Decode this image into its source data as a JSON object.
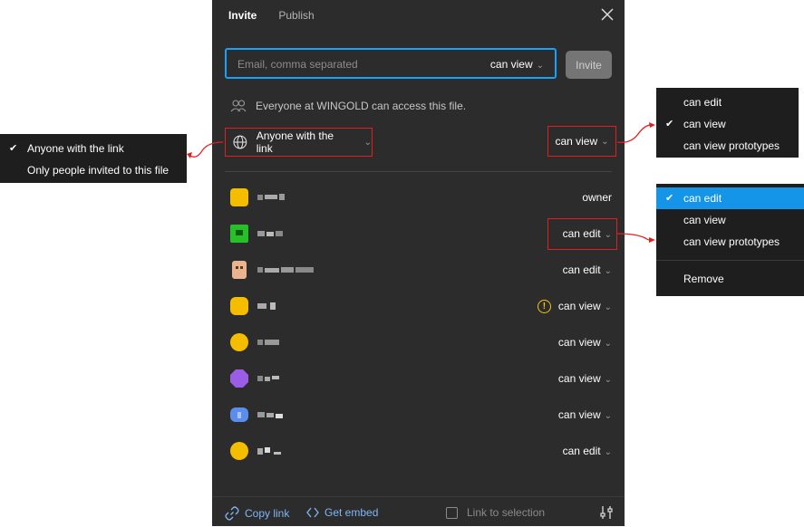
{
  "tabs": [
    {
      "label": "Invite",
      "active": true
    },
    {
      "label": "Publish",
      "active": false
    }
  ],
  "invite": {
    "placeholder": "Email, comma separated",
    "permission": "can view",
    "button": "Invite"
  },
  "org_access": "Everyone at WINGOLD can access this file.",
  "link_access": {
    "label": "Anyone with the link",
    "permission": "can view"
  },
  "users": [
    {
      "permission": "owner",
      "avatar_color": "#f5bd00"
    },
    {
      "permission": "can edit",
      "avatar_color": "#28c028"
    },
    {
      "permission": "can edit",
      "avatar_color": "#e9b48f"
    },
    {
      "permission": "can view",
      "avatar_color": "#f5bd00",
      "warning": true
    },
    {
      "permission": "can view",
      "avatar_color": "#f5bd00"
    },
    {
      "permission": "can view",
      "avatar_color": "#9b5de5"
    },
    {
      "permission": "can view",
      "avatar_color": "#5b8ded"
    },
    {
      "permission": "can edit",
      "avatar_color": "#f5bd00"
    }
  ],
  "footer": {
    "copy_link": "Copy link",
    "get_embed": "Get embed",
    "link_to_selection": "Link to selection"
  },
  "link_menu": {
    "items": [
      {
        "label": "Anyone with the link",
        "checked": true
      },
      {
        "label": "Only people invited to this file",
        "checked": false
      }
    ]
  },
  "link_perm_menu": {
    "items": [
      {
        "label": "can edit",
        "checked": false
      },
      {
        "label": "can view",
        "checked": true
      },
      {
        "label": "can view prototypes",
        "checked": false
      }
    ]
  },
  "user_perm_menu": {
    "items": [
      {
        "label": "can edit",
        "checked": true
      },
      {
        "label": "can view",
        "checked": false
      },
      {
        "label": "can view prototypes",
        "checked": false
      }
    ],
    "remove": "Remove"
  },
  "colors": {
    "accent": "#18a0fb",
    "highlight": "#e0201f",
    "link": "#7fb6f5",
    "warning": "#f2c418"
  }
}
